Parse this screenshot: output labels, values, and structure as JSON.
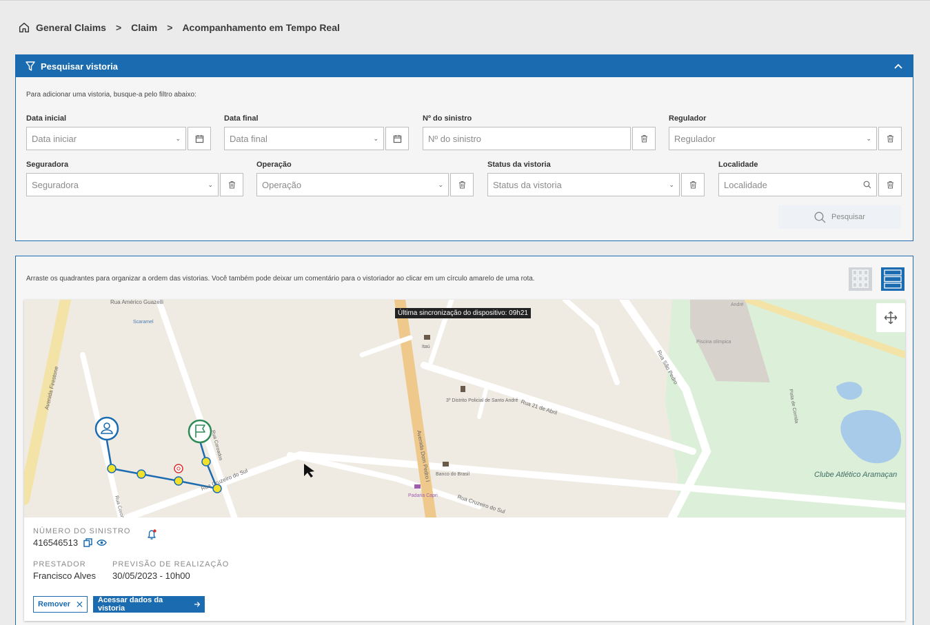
{
  "breadcrumb": {
    "items": [
      "General Claims",
      "Claim",
      "Acompanhamento em Tempo Real"
    ],
    "separator": ">"
  },
  "filter": {
    "title": "Pesquisar vistoria",
    "hint": "Para adicionar uma vistoria, busque-a pelo filtro abaixo:",
    "fields": {
      "data_inicial": {
        "label": "Data inicial",
        "placeholder": "Data iniciar"
      },
      "data_final": {
        "label": "Data final",
        "placeholder": "Data final"
      },
      "sinistro": {
        "label": "Nº do sinistro",
        "placeholder": "Nº do sinistro"
      },
      "regulador": {
        "label": "Regulador",
        "placeholder": "Regulador"
      },
      "seguradora": {
        "label": "Seguradora",
        "placeholder": "Seguradora"
      },
      "operacao": {
        "label": "Operação",
        "placeholder": "Operação"
      },
      "status": {
        "label": "Status da vistoria",
        "placeholder": "Status da vistoria"
      },
      "localidade": {
        "label": "Localidade",
        "placeholder": "Localidade"
      }
    },
    "search_label": "Pesquisar"
  },
  "main": {
    "instructions": "Arraste os quadrantes para organizar a ordem das vistorias. Você também pode deixar um comentário para o vistoriador ao clicar em um círculo amarelo de uma rota.",
    "map": {
      "sync_tooltip": "Última sincronização do dispositivo: 09h21",
      "labels": {
        "r1": "Rua Américo Guazelli",
        "r2": "Scaramel",
        "r3": "Avenida Firestone",
        "r4": "Itaú",
        "r5": "3º Distrito Policial de Santo André",
        "r6": "Rua 21 de Abril",
        "r7": "Avenida Dom Pedro I",
        "r8": "Rua Cruzeiro do Sul",
        "r9": "Rua Cruzeiro do Sul",
        "r10": "Banco do Brasil",
        "r11": "Padaria Capri",
        "r12": "Rua São Pedro",
        "r13": "Piscina olímpica",
        "r14": "Pista de Corrida",
        "r15": "Clube Atlético Aramaçan",
        "r16": "André",
        "r17": "Rua Coronel",
        "r18": "Rua Coroados"
      }
    },
    "claim": {
      "numero_label": "Número do sinistro",
      "numero_value": "416546513",
      "prestador_label": "Prestador",
      "prestador_value": "Francisco Alves",
      "previsao_label": "Previsão de realização",
      "previsao_value": "30/05/2023 - 10h00"
    },
    "buttons": {
      "remove": "Remover",
      "access": "Acessar dados da vistoria"
    }
  },
  "colors": {
    "primary": "#1b6bb0",
    "route": "#1b6bb0",
    "waypoint": "#f2e12b",
    "flag": "#2e8b57",
    "alert": "#d8302f"
  }
}
